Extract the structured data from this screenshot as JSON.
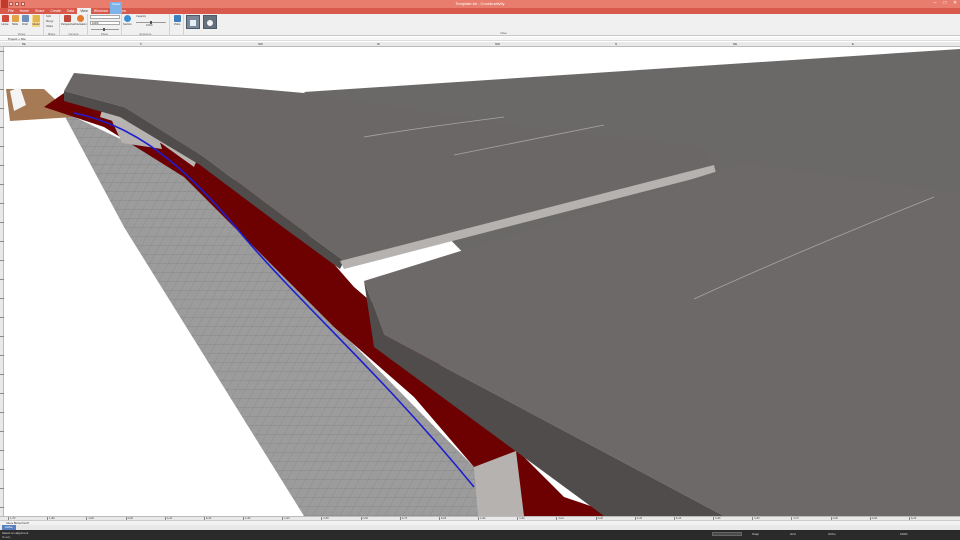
{
  "window": {
    "title": "Template.tin - Constructivity",
    "controls": {
      "minimize": "–",
      "maximize": "□",
      "close": "✕"
    }
  },
  "ribbon": {
    "tabs": [
      "File",
      "Home",
      "Share",
      "Create",
      "Data",
      "View",
      "Windows",
      "Options"
    ],
    "active_tab": "View",
    "context_tab": "Views",
    "groups": [
      {
        "label": "Views",
        "buttons": [
          "Home",
          "Table",
          "Draft",
          "Model"
        ]
      },
      {
        "label": "Slides",
        "buttons": [
          "Split",
          "Merge",
          "Slides"
        ]
      },
      {
        "label": "Camera",
        "buttons": [
          "Perspective",
          "Orientation"
        ]
      },
      {
        "label": "Plane",
        "buttons": [
          "Section"
        ]
      },
      {
        "label": "Exposure",
        "buttons": [
          "Capacity"
        ]
      },
      {
        "label": "Video",
        "buttons": [
          "Video"
        ]
      },
      {
        "label": "",
        "buttons": [
          "Render",
          "Light"
        ]
      }
    ],
    "zoom_value": "100%",
    "opacity_value": "100%",
    "capacity_label": "Capacity"
  },
  "breadcrumb": "Project  »  Site",
  "top_ruler": [
    "5E",
    "5",
    "SW",
    "W",
    "NW",
    "N",
    "NE",
    "E"
  ],
  "station_labels": [
    "1+70",
    "1+80",
    "1+90",
    "2+00",
    "2+10",
    "2+20",
    "2+30",
    "2+40",
    "2+50",
    "2+60",
    "2+70",
    "2+80",
    "2+90",
    "3+00",
    "3+10",
    "3+20",
    "3+30",
    "3+40",
    "3+50",
    "3+60",
    "3+70",
    "3+80",
    "3+90",
    "4+00"
  ],
  "doc_tabs": "Site  ▸  Bkd  ▸  Pad 8",
  "doc_tab_pill": "Active",
  "status": {
    "line1": "Select an alignment",
    "line2": "Ready",
    "items": [
      "Snap",
      "Grid",
      "Ortho",
      "100%"
    ]
  },
  "colors": {
    "title_bar": "#e87d6e",
    "tab_bar": "#d85a4c",
    "deck": "#6a6766",
    "deck_edge": "#4f4c4b",
    "pavement_red": "#6d0000",
    "alignment_blue": "#1e1ed2",
    "abutment": "#b5b2b0",
    "grid_floor": "#9c9c9c"
  }
}
